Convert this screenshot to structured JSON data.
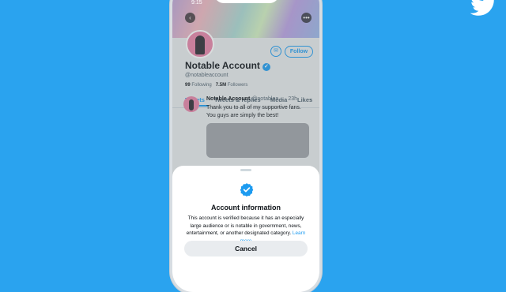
{
  "status_bar": {
    "time": "9:15"
  },
  "profile": {
    "name": "Notable Account",
    "handle": "@notableaccount",
    "following_count": "99",
    "following_label": "Following",
    "followers_count": "7.5M",
    "followers_label": "Followers",
    "follow_label": "Follow",
    "message_icon": "mail-icon",
    "back_icon": "chevron-left",
    "more_icon": "ellipsis"
  },
  "tabs": [
    {
      "label": "Tweets",
      "active": true
    },
    {
      "label": "Tweets & replies"
    },
    {
      "label": "Media"
    },
    {
      "label": "Likes"
    }
  ],
  "tweet": {
    "author": "Notable Account",
    "handle": "@notablea...",
    "time": "· 23h",
    "text": "Thank you to all of my supportive fans. You guys are simply the best!"
  },
  "sheet": {
    "title": "Account information",
    "body": "This account is verified because it has an especially large audience or is notable in government, news, entertainment, or another designated category.",
    "learn_more": "Learn more",
    "cancel": "Cancel"
  },
  "colors": {
    "background": "#2aa3ef",
    "accent": "#1d9bf0",
    "text": "#0f1419"
  }
}
